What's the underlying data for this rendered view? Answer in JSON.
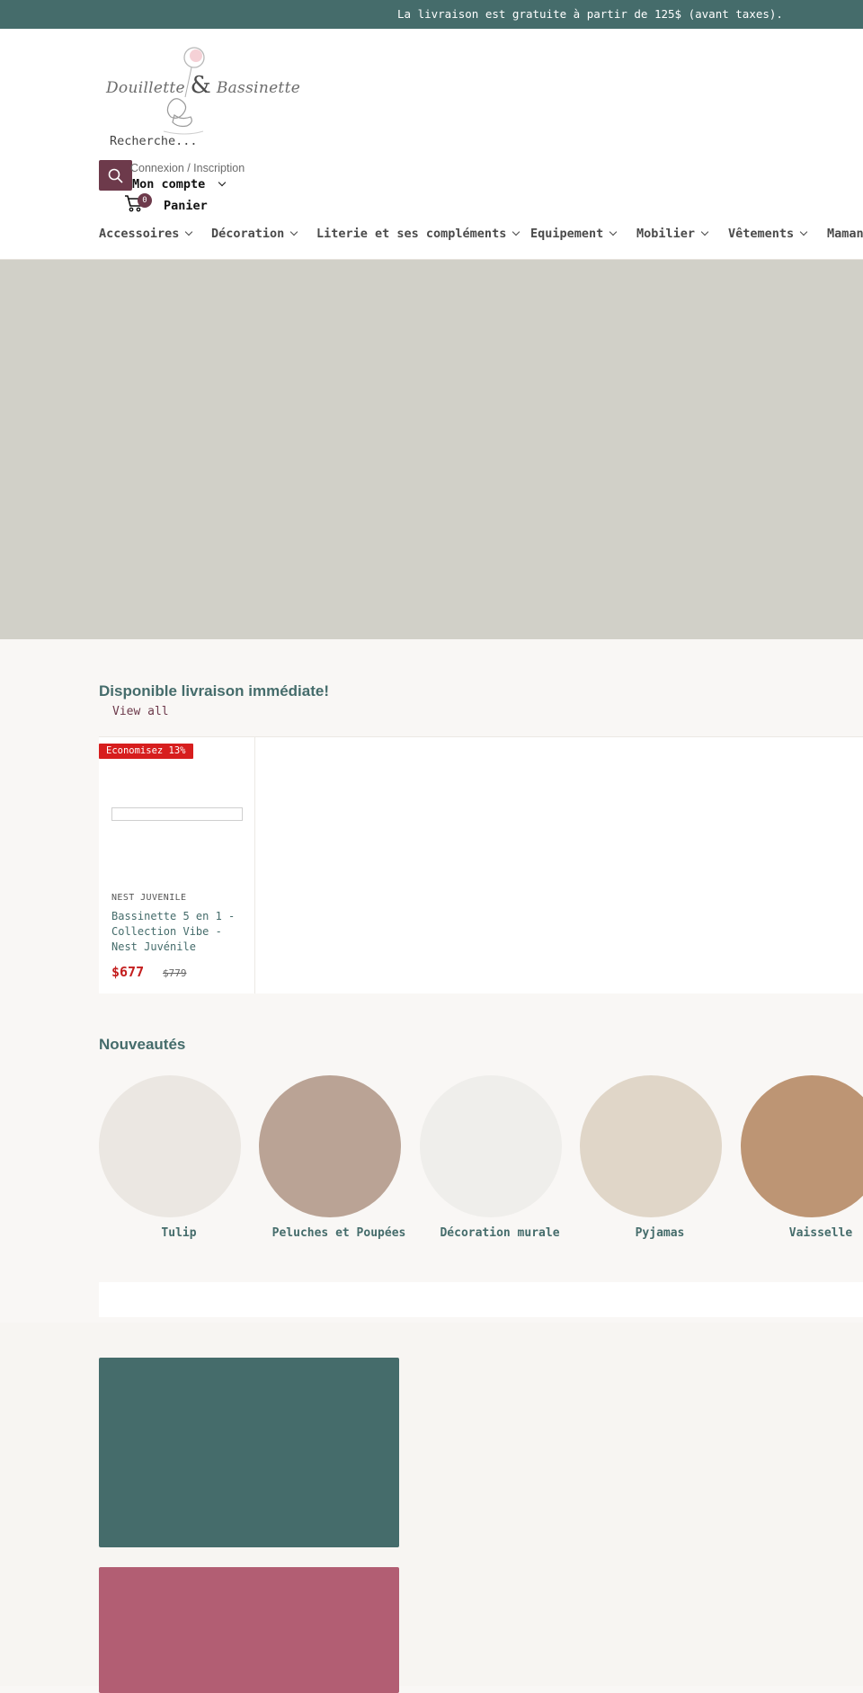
{
  "announcement": {
    "text": "La livraison est gratuite à partir de 125$ (avant taxes)."
  },
  "header": {
    "logo": {
      "word1": "Douillette",
      "amp": "&",
      "word2": "Bassinette"
    },
    "search": {
      "placeholder": "Recherche..."
    },
    "account": {
      "login_label": "Connexion / Inscription",
      "account_label": "Mon compte"
    },
    "cart": {
      "count": "0",
      "label": "Panier"
    }
  },
  "nav": {
    "items": [
      {
        "label": "Accessoires"
      },
      {
        "label": "Décoration"
      },
      {
        "label": "Literie et ses compléments"
      },
      {
        "label": "Equipement"
      },
      {
        "label": "Mobilier"
      },
      {
        "label": "Vêtements"
      },
      {
        "label": "Maman"
      }
    ]
  },
  "featured": {
    "title": "Disponible livraison immédiate!",
    "view_all": "View all",
    "products": [
      {
        "badge": "Economisez 13%",
        "vendor": "NEST JUVENILE",
        "title": "Bassinette 5 en 1 - Collection Vibe - Nest Juvénile",
        "price": "$677",
        "compare_price": "$779"
      }
    ]
  },
  "new_arrivals": {
    "title": "Nouveautés",
    "collections": [
      {
        "label": "Tulip",
        "color": "#ebe7e2"
      },
      {
        "label": "Peluches et Poupées",
        "color": "#baa395"
      },
      {
        "label": "Décoration murale",
        "color": "#efeeeb"
      },
      {
        "label": "Pyjamas",
        "color": "#e0d6c8"
      },
      {
        "label": "Vaisselle",
        "color": "#bd9574"
      }
    ]
  },
  "theme": {
    "accent": "#456c6b",
    "brand": "#6d3a4b",
    "sale": "#d71e1e",
    "promo_colors": [
      "#456c6b",
      "#b25e73"
    ]
  }
}
